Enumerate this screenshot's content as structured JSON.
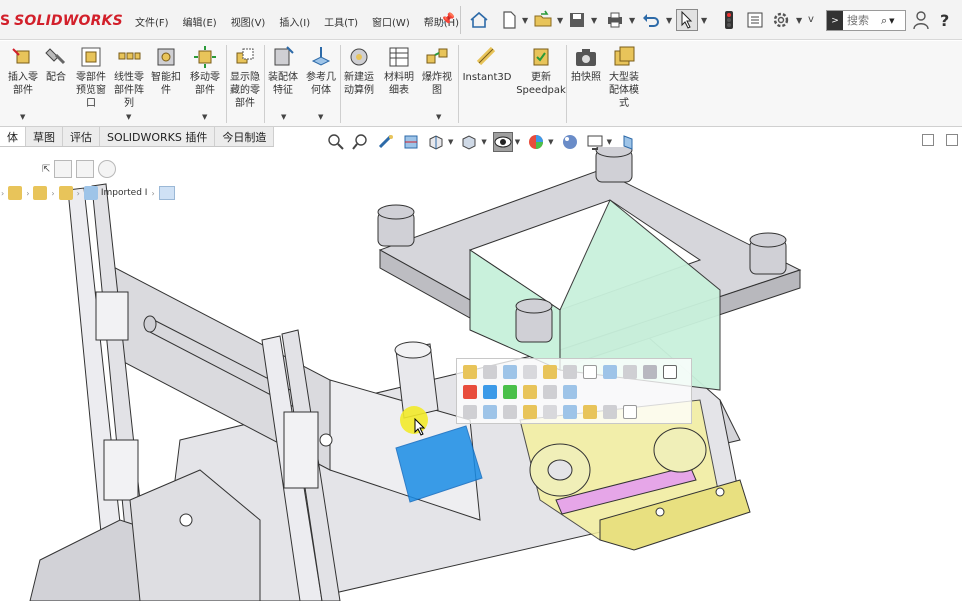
{
  "app": {
    "name": "SOLIDWORKS",
    "accent": "#d21f2a"
  },
  "menu": {
    "items": [
      "文件(F)",
      "编辑(E)",
      "视图(V)",
      "插入(I)",
      "工具(T)",
      "窗口(W)",
      "帮助(H)"
    ]
  },
  "quick_access": {
    "icons": [
      "home-icon",
      "new-document-icon",
      "open-icon",
      "save-icon",
      "print-icon",
      "undo-icon",
      "select-icon",
      "traffic-light-icon",
      "file-properties-icon",
      "gear-icon"
    ],
    "overflow_label": "v"
  },
  "search": {
    "placeholder": "搜索",
    "value": "搜索"
  },
  "help": {
    "label": "?"
  },
  "ribbon": {
    "buttons": [
      {
        "label": "插入零\n部件",
        "icon": "insert-component-icon"
      },
      {
        "label": "配合",
        "icon": "mate-icon"
      },
      {
        "label": "零部件\n预览窗\n口",
        "icon": "component-preview-icon"
      },
      {
        "label": "线性零\n部件阵\n列",
        "icon": "linear-pattern-icon"
      },
      {
        "label": "智能扣\n件",
        "icon": "smart-fastener-icon"
      },
      {
        "label": "移动零\n部件",
        "icon": "move-component-icon"
      },
      {
        "label": "显示隐\n藏的零\n部件",
        "icon": "show-hidden-icon"
      },
      {
        "label": "装配体\n特征",
        "icon": "assembly-feature-icon"
      },
      {
        "label": "参考几\n何体",
        "icon": "reference-geometry-icon"
      },
      {
        "label": "新建运\n动算例",
        "icon": "motion-study-icon"
      },
      {
        "label": "材料明\n细表",
        "icon": "bom-icon"
      },
      {
        "label": "爆炸视\n图",
        "icon": "exploded-view-icon"
      },
      {
        "label": "Instant3D",
        "icon": "instant3d-icon"
      },
      {
        "label": "更新\nSpeedpak",
        "icon": "speedpak-icon"
      },
      {
        "label": "拍快照",
        "icon": "snapshot-icon"
      },
      {
        "label": "大型装\n配体模\n式",
        "icon": "large-assembly-icon"
      }
    ]
  },
  "tabs": [
    "体",
    "草图",
    "评估",
    "SOLIDWORKS 插件",
    "今日制造"
  ],
  "active_tab_index": 0,
  "hud": {
    "icons": [
      "zoom-to-fit-icon",
      "zoom-area-icon",
      "previous-view-icon",
      "section-view-icon",
      "view-orientation-icon",
      "display-style-icon",
      "hide-show-icon",
      "appearance-icon",
      "scene-icon",
      "monitor-icon",
      "view-settings-icon"
    ]
  },
  "feature_tree": {
    "breadcrumb_label": "Imported I"
  },
  "context_toolbar": {
    "row1_icons": [
      "edit-icon",
      "mate-icon",
      "hide-icon",
      "transparency-icon",
      "isolate-icon",
      "open-part-icon",
      "rebuild-icon",
      "view-icon",
      "suppress-icon",
      "appearance-icon",
      "properties-icon"
    ],
    "row2_icons": [
      "component-icon",
      "copy-icon",
      "color-icon",
      "move-icon",
      "rotate-icon",
      "config-icon"
    ],
    "row3_icons": [
      "select-other-icon",
      "zoom-icon",
      "normal-to-icon",
      "sketch-icon",
      "tree-icon",
      "part-icon",
      "assembly-icon",
      "reference-icon",
      "settings-icon"
    ]
  },
  "colors": {
    "part_grey": "#d8d8dc",
    "part_edge": "#333333",
    "highlight_green": "#c9f1dc",
    "highlight_yellow": "#f5f0a0",
    "highlight_pink": "#e6a6e8",
    "selection_blue": "#1a8de6",
    "ribbon_bg": "#f7f7f7"
  }
}
